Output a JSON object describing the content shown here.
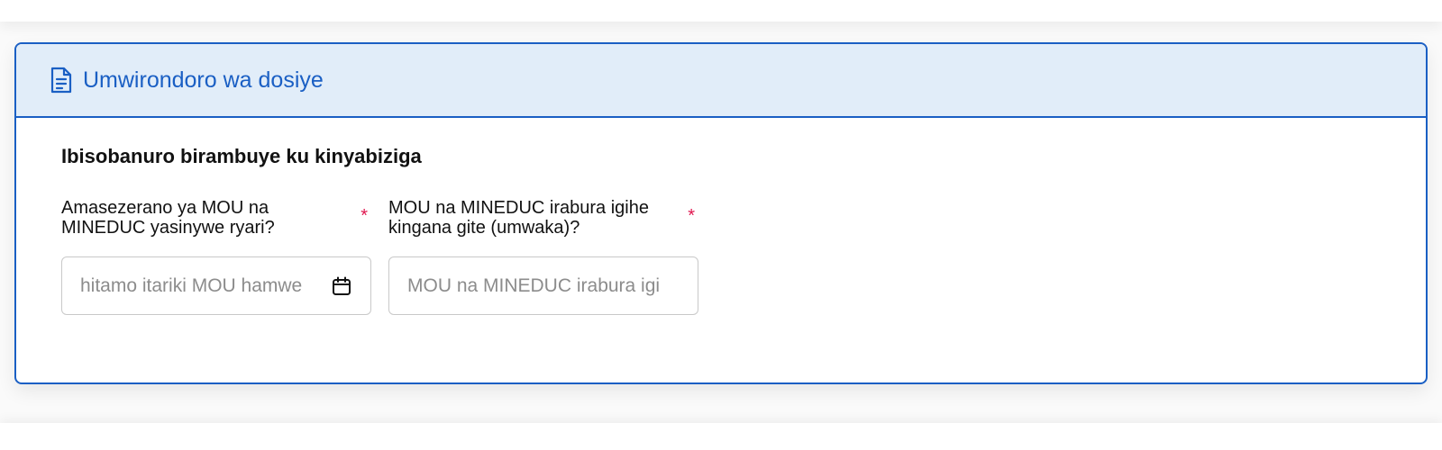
{
  "panel": {
    "title": "Umwirondoro wa dosiye",
    "header_icon": "document-icon",
    "section_title": "Ibisobanuro birambuye ku kinyabiziga"
  },
  "fields": [
    {
      "label": "Amasezerano ya MOU na MINEDUC yasinywe ryari?",
      "required_mark": "*",
      "placeholder": "hitamo itariki MOU hamwe",
      "value": "",
      "icon": "calendar-icon"
    },
    {
      "label": "MOU na MINEDUC irabura igihe kingana gite (umwaka)?",
      "required_mark": "*",
      "placeholder": "MOU na MINEDUC irabura igi",
      "value": ""
    }
  ],
  "colors": {
    "accent": "#1a5fc4",
    "header_bg": "#e1edf9",
    "required": "#e0174f",
    "input_border": "#c9c9c9"
  }
}
